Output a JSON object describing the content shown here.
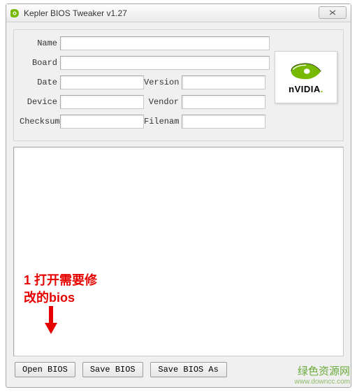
{
  "window": {
    "title": "Kepler BIOS Tweaker v1.27",
    "close": "✕"
  },
  "fields": {
    "name_label": "Name",
    "name_value": "",
    "board_label": "Board",
    "board_value": "",
    "date_label": "Date",
    "date_value": "",
    "version_label": "Version",
    "version_value": "",
    "device_label": "Device",
    "device_value": "",
    "vendor_label": "Vendor",
    "vendor_value": "",
    "checksum_label": "Checksum",
    "checksum_value": "",
    "filename_label": "Filenam",
    "filename_value": ""
  },
  "logo": {
    "brand_n": "n",
    "brand_rest": "VIDIA",
    "brand_dot": "."
  },
  "annotation": {
    "line1": "1 打开需要修",
    "line2": "改的bios"
  },
  "buttons": {
    "open": "Open BIOS",
    "save": "Save BIOS",
    "saveas": "Save BIOS As"
  },
  "watermark": {
    "title": "绿色资源网",
    "url": "www.downcc.com"
  }
}
